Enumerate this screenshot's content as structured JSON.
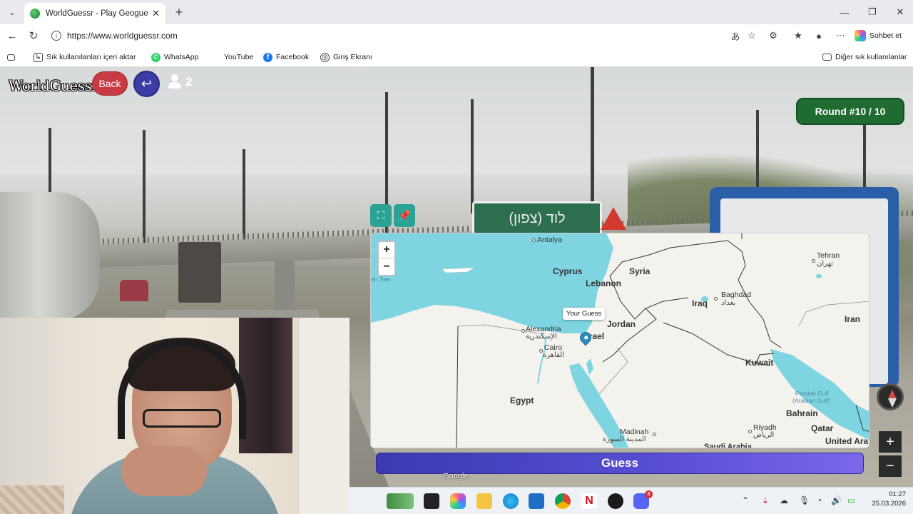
{
  "browser": {
    "tab_title": "WorldGuessr - Play Geoguessr for",
    "url": "https://www.worldguessr.com",
    "copilot_label": "Sohbet et",
    "bookmarks": [
      {
        "label": "Sık kullanılanları içeri aktar",
        "icon": "import-icon"
      },
      {
        "label": "WhatsApp",
        "icon": "whatsapp-icon"
      },
      {
        "label": "YouTube",
        "icon": "youtube-icon"
      },
      {
        "label": "Facebook",
        "icon": "facebook-icon"
      },
      {
        "label": "Giriş Ekranı",
        "icon": "globe-icon"
      }
    ],
    "other_bookmarks": "Diğer sık kullanılanlar"
  },
  "game": {
    "brand": "WorldGuessr",
    "back_label": "Back",
    "player_count": "2",
    "round_label": "Round #10 / 10",
    "guess_label": "Guess",
    "google_watermark": "Google",
    "street_sign_text": "לוד (צפון)"
  },
  "map": {
    "zoom_in": "+",
    "zoom_out": "−",
    "tooltip": "Your Guess",
    "labels": {
      "antalya": "Antalya",
      "cyprus": "Cyprus",
      "syria": "Syria",
      "lebanon": "Lebanon",
      "tehran": "Tehran",
      "tehran_ar": "تهران",
      "baghdad": "Baghdad",
      "baghdad_ar": "بغداد",
      "iraq": "Iraq",
      "iran": "Iran",
      "alexandria": "Alexandria",
      "alexandria_ar": "الإسكندرية",
      "israel": "srael",
      "jordan": "Jordan",
      "cairo": "Cairo",
      "cairo_ar": "القاهرة",
      "kuwait": "Kuwait",
      "egypt": "Egypt",
      "persian_gulf": "Persian Gulf",
      "arabian_gulf": "(Arabian Gulf)",
      "bahrain": "Bahrain",
      "qatar": "Qatar",
      "riyadh": "Riyadh",
      "riyadh_ar": "الرياض",
      "madinah": "Madinah",
      "madinah_ar": "المدينة المنورة",
      "saudi": "Saudi Arabia",
      "uae": "United Ara",
      "sea": "an Sea"
    }
  },
  "taskbar": {
    "time": "01:27",
    "date": "25.03.2026",
    "discord_badge": "3"
  },
  "colors": {
    "round_badge": "#1f6b31",
    "back_button": "#c83b43",
    "guess_button": "#4b45c6",
    "water": "#7fd4e1",
    "map_button": "#2aa295"
  }
}
